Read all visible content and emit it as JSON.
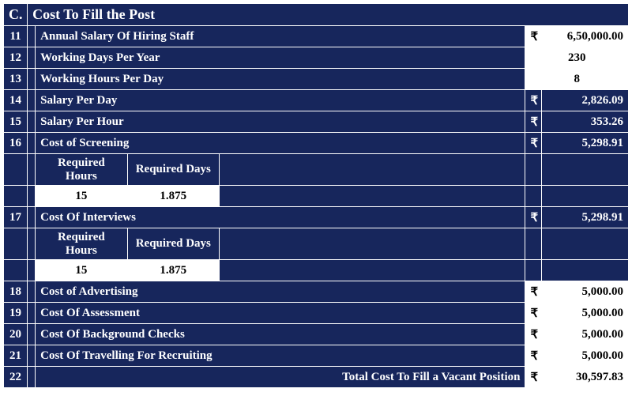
{
  "section": {
    "letter": "C.",
    "title": "Cost To Fill the Post"
  },
  "sub": {
    "req_hours": "Required Hours",
    "req_days": "Required Days",
    "screening_hours": "15",
    "screening_days": "1.875",
    "interview_hours": "15",
    "interview_days": "1.875"
  },
  "rows": {
    "r11": {
      "n": "11",
      "label": "Annual Salary Of Hiring Staff",
      "sym": "₹",
      "val": "6,50,000.00",
      "style": "white"
    },
    "r12": {
      "n": "12",
      "label": "Working Days Per Year",
      "sym": "",
      "val": "230",
      "style": "white-center"
    },
    "r13": {
      "n": "13",
      "label": "Working Hours Per Day",
      "sym": "",
      "val": "8",
      "style": "white-center"
    },
    "r14": {
      "n": "14",
      "label": "Salary Per Day",
      "sym": "₹",
      "val": "2,826.09",
      "style": "navy"
    },
    "r15": {
      "n": "15",
      "label": "Salary Per Hour",
      "sym": "₹",
      "val": "353.26",
      "style": "navy"
    },
    "r16": {
      "n": "16",
      "label": "Cost of Screening",
      "sym": "₹",
      "val": "5,298.91",
      "style": "navy"
    },
    "r17": {
      "n": "17",
      "label": "Cost Of Interviews",
      "sym": "₹",
      "val": "5,298.91",
      "style": "navy"
    },
    "r18": {
      "n": "18",
      "label": "Cost of Advertising",
      "sym": "₹",
      "val": "5,000.00",
      "style": "white"
    },
    "r19": {
      "n": "19",
      "label": "Cost Of Assessment",
      "sym": "₹",
      "val": "5,000.00",
      "style": "white"
    },
    "r20": {
      "n": "20",
      "label": "Cost Of Background Checks",
      "sym": "₹",
      "val": "5,000.00",
      "style": "white"
    },
    "r21": {
      "n": "21",
      "label": "Cost Of Travelling For Recruiting",
      "sym": "₹",
      "val": "5,000.00",
      "style": "white"
    },
    "r22": {
      "n": "22",
      "label": "Total Cost To Fill a Vacant Position",
      "sym": "₹",
      "val": "30,597.83",
      "style": "white"
    }
  }
}
